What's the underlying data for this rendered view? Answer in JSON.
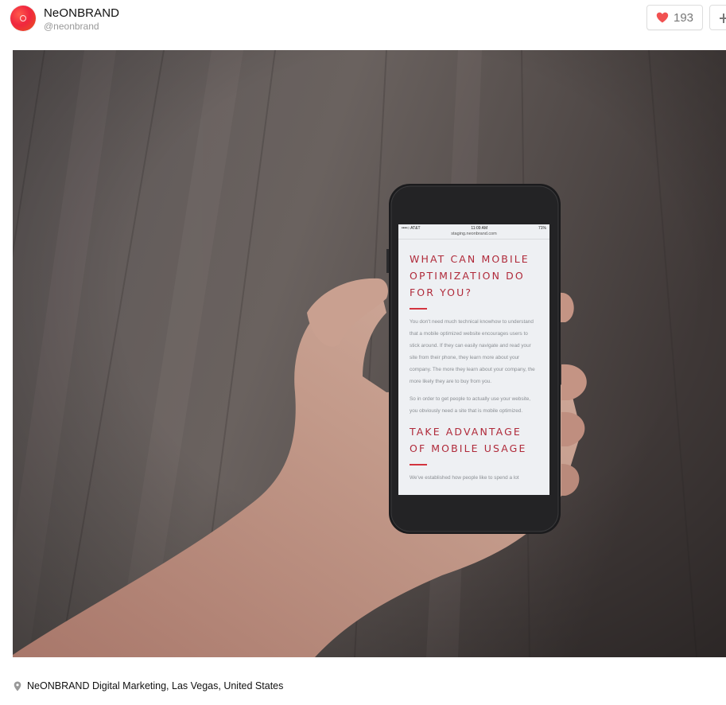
{
  "user": {
    "name": "NeONBRAND",
    "handle": "@neonbrand"
  },
  "actions": {
    "like_count": "193",
    "like_icon": "heart-icon",
    "add_icon": "plus-icon"
  },
  "photo": {
    "phone_screen": {
      "status_carrier": "••••○ AT&T",
      "status_time": "11:09 AM",
      "status_battery": "71%",
      "url": "staging.neonbrand.com",
      "heading1": "WHAT CAN MOBILE OPTIMIZATION DO FOR YOU?",
      "paragraph1": "You don't need much technical knowhow to understand that a mobile optimized website encourages users to stick around. If they can easily navigate and read your site from their phone, they learn more about your company. The more they learn about your company, the more likely they are to buy from you.",
      "paragraph2": "So in order to get people to actually use your website, you obviously need a site that is mobile optimized.",
      "heading2": "TAKE ADVANTAGE OF MOBILE USAGE",
      "paragraph3": "We've established how people like to spend a lot"
    }
  },
  "location": {
    "icon": "map-pin-icon",
    "text": "NeONBRAND Digital Marketing, Las Vegas, United States"
  },
  "colors": {
    "heart": "#f15151",
    "accent_red": "#b02a3a",
    "border": "#dddddd"
  }
}
